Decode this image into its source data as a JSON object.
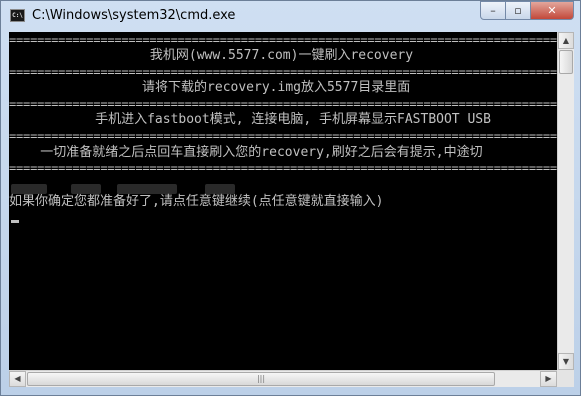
{
  "window": {
    "title": "C:\\Windows\\system32\\cmd.exe",
    "icon_text": "C:\\",
    "controls": {
      "minimize": "–",
      "maximize": "▫",
      "close": "✕"
    }
  },
  "console": {
    "separator": "================================================================================",
    "lines": [
      "                  我机网(www.5577.com)一键刷入recovery",
      "                 请将下载的recovery.img放入5577目录里面",
      "           手机进入fastboot模式, 连接电脑, 手机屏幕显示FASTBOOT USB",
      "    一切准备就绪之后点回车直接刷入您的recovery,刷好之后会有提示,中途切",
      "如果你确定您都准备好了,请点任意键继续(点任意键就直接输入)"
    ]
  },
  "scrollbar": {
    "up": "▲",
    "down": "▼",
    "left": "◀",
    "right": "▶",
    "thumb_grip": "|||"
  }
}
